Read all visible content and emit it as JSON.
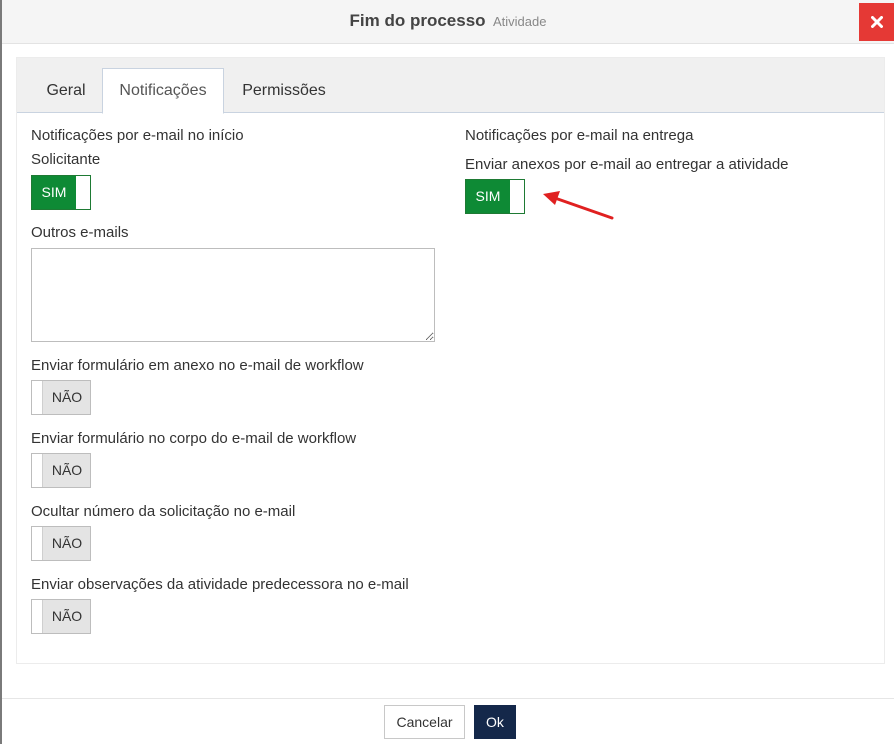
{
  "dialog": {
    "title": "Fim do processo",
    "subtitle": "Atividade",
    "close_icon": "close-icon",
    "accent_close": "#e53935"
  },
  "tabs": [
    {
      "label": "Geral",
      "active": false
    },
    {
      "label": "Notificações",
      "active": true
    },
    {
      "label": "Permissões",
      "active": false
    }
  ],
  "left": {
    "start_heading": "Notificações por e-mail no início",
    "solicitante_label": "Solicitante",
    "solicitante_toggle": "SIM",
    "outros_label": "Outros e-mails",
    "outros_value": "",
    "form_anexo_label": "Enviar formulário em anexo no e-mail de workflow",
    "form_anexo_toggle": "NÃO",
    "form_corpo_label": "Enviar formulário no corpo do e-mail de workflow",
    "form_corpo_toggle": "NÃO",
    "ocultar_label": "Ocultar número da solicitação no e-mail",
    "ocultar_toggle": "NÃO",
    "observacoes_label": "Enviar observações da atividade predecessora no e-mail",
    "observacoes_toggle": "NÃO"
  },
  "right": {
    "delivery_heading": "Notificações por e-mail na entrega",
    "anexos_label": "Enviar anexos por e-mail ao entregar a atividade",
    "anexos_toggle": "SIM"
  },
  "annotation": {
    "arrow_color": "#e02020"
  },
  "footer": {
    "cancel_label": "Cancelar",
    "ok_label": "Ok",
    "ok_color": "#14284a"
  },
  "colors": {
    "toggle_on": "#0e8a35",
    "toggle_off": "#e4e4e4"
  }
}
